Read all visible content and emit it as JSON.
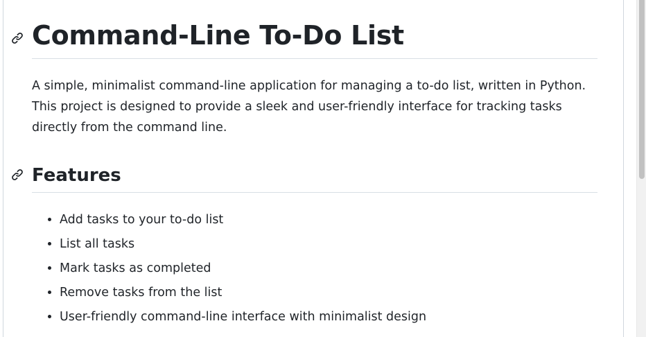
{
  "document": {
    "title": "Command-Line To-Do List",
    "intro": "A simple, minimalist command-line application for managing a to-do list, written in Python. This project is designed to provide a sleek and user-friendly interface for tracking tasks directly from the command line.",
    "features_heading": "Features",
    "features": [
      "Add tasks to your to-do list",
      "List all tasks",
      "Mark tasks as completed",
      "Remove tasks from the list",
      "User-friendly command-line interface with minimalist design"
    ]
  },
  "icons": {
    "heading_anchor": "link-icon",
    "list_marker": "bullet"
  },
  "colors": {
    "text": "#1f2328",
    "divider": "#d8dee4",
    "panel_border": "#d0d7de",
    "scrollbar_thumb": "#c1c1c1"
  }
}
